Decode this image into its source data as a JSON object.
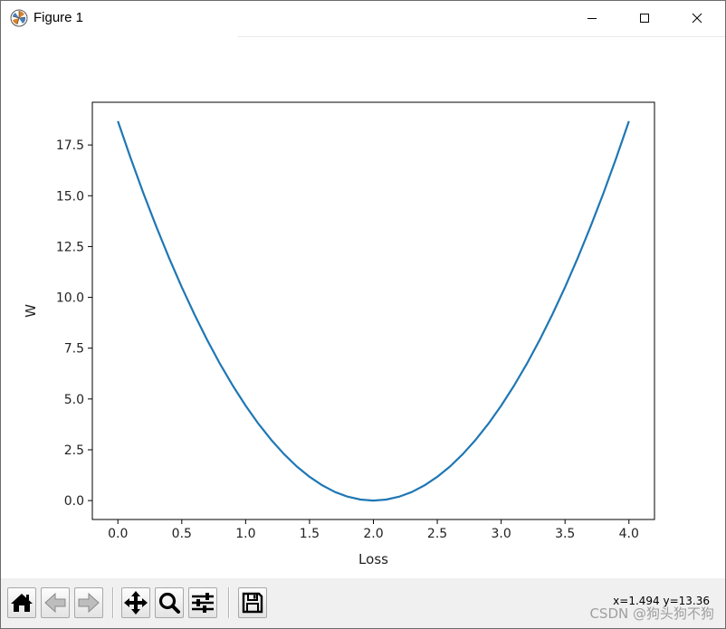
{
  "window": {
    "title": "Figure 1"
  },
  "chart_data": {
    "type": "line",
    "title": "",
    "xlabel": "Loss",
    "ylabel": "W",
    "xlim": [
      -0.2,
      4.2
    ],
    "ylim": [
      -0.93,
      19.6
    ],
    "xticks": [
      0.0,
      0.5,
      1.0,
      1.5,
      2.0,
      2.5,
      3.0,
      3.5,
      4.0
    ],
    "xtick_labels": [
      "0.0",
      "0.5",
      "1.0",
      "1.5",
      "2.0",
      "2.5",
      "3.0",
      "3.5",
      "4.0"
    ],
    "yticks": [
      0.0,
      2.5,
      5.0,
      7.5,
      10.0,
      12.5,
      15.0,
      17.5
    ],
    "ytick_labels": [
      "0.0",
      "2.5",
      "5.0",
      "7.5",
      "10.0",
      "12.5",
      "15.0",
      "17.5"
    ],
    "grid": false,
    "series": [
      {
        "color": "#1f77b4",
        "x": [
          0.0,
          0.1,
          0.2,
          0.3,
          0.4,
          0.5,
          0.6,
          0.7,
          0.8,
          0.9,
          1.0,
          1.1,
          1.2,
          1.3,
          1.4,
          1.5,
          1.6,
          1.7,
          1.8,
          1.9,
          2.0,
          2.1,
          2.2,
          2.3,
          2.4,
          2.5,
          2.6,
          2.7,
          2.8,
          2.9,
          3.0,
          3.1,
          3.2,
          3.3,
          3.4,
          3.5,
          3.6,
          3.7,
          3.8,
          3.9,
          4.0
        ],
        "y": [
          18.67,
          16.85,
          15.12,
          13.49,
          11.95,
          10.5,
          9.15,
          7.89,
          6.72,
          5.65,
          4.67,
          3.78,
          2.99,
          2.29,
          1.68,
          1.17,
          0.75,
          0.42,
          0.19,
          0.05,
          0.0,
          0.05,
          0.19,
          0.42,
          0.75,
          1.17,
          1.68,
          2.29,
          2.99,
          3.78,
          4.67,
          5.65,
          6.72,
          7.89,
          9.15,
          10.5,
          11.95,
          13.49,
          15.12,
          16.85,
          18.67
        ]
      }
    ]
  },
  "toolbar": {
    "buttons": [
      {
        "name": "home-button",
        "icon": "home-icon"
      },
      {
        "name": "back-button",
        "icon": "back-arrow-icon"
      },
      {
        "name": "forward-button",
        "icon": "forward-arrow-icon"
      },
      {
        "name": "pan-button",
        "icon": "move-icon"
      },
      {
        "name": "zoom-button",
        "icon": "magnifier-icon"
      },
      {
        "name": "configure-subplots-button",
        "icon": "sliders-icon"
      },
      {
        "name": "save-button",
        "icon": "floppy-disk-icon"
      }
    ],
    "coordinates": "x=1.494 y=13.36"
  },
  "watermark": "CSDN @狗头狗不狗"
}
